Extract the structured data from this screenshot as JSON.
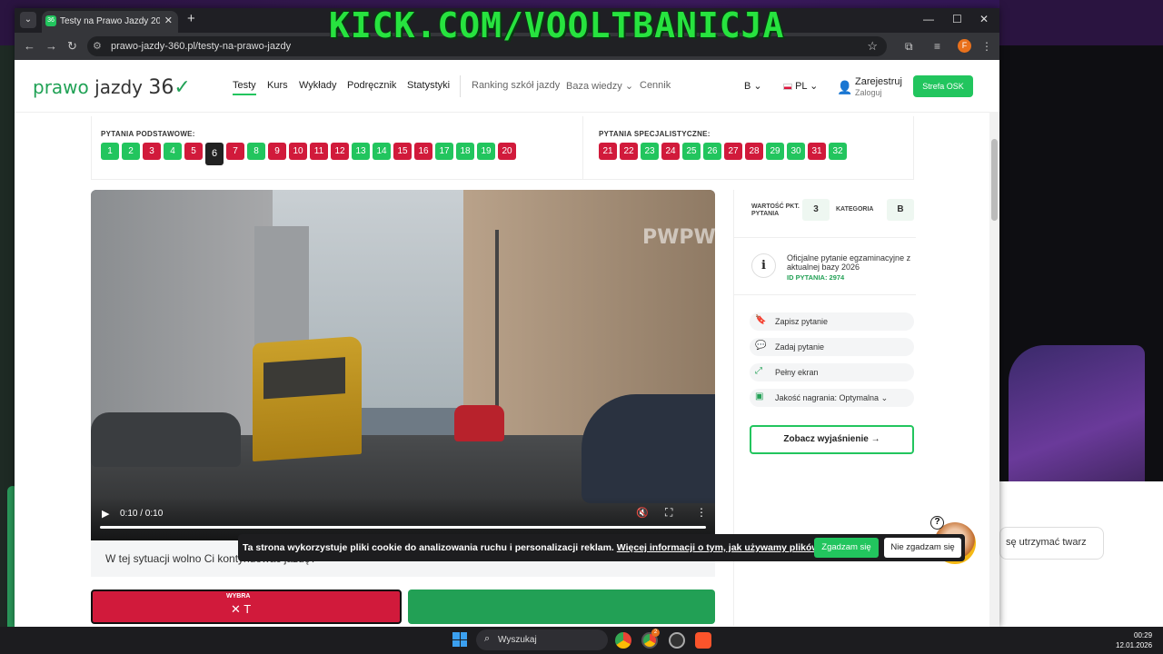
{
  "overlay": {
    "watermark": "KICK.COM/VOOLTBANICJA"
  },
  "browser": {
    "tab_title": "Testy na Prawo Jazdy 2026 - Da",
    "tab_favicon": "36",
    "url": "prawo-jazdy-360.pl/testy-na-prawo-jazdy",
    "profile_initial": "F"
  },
  "site": {
    "logo": {
      "word1": "prawo",
      "word2": "jazdy",
      "num": "36"
    },
    "menu": [
      "Testy",
      "Kurs",
      "Wykłady",
      "Podręcznik",
      "Statystyki"
    ],
    "menu_secondary": [
      "Ranking szkół jazdy",
      "Baza wiedzy",
      "Cennik"
    ],
    "category_select": "B",
    "language_select": "PL",
    "register": "Zarejestruj",
    "login": "Zaloguj",
    "osk_button": "Strefa OSK"
  },
  "questions": {
    "basic_label": "PYTANIA PODSTAWOWE:",
    "special_label": "PYTANIA SPECJALISTYCZNE:",
    "current": 6,
    "basic": [
      {
        "n": "1",
        "s": "g"
      },
      {
        "n": "2",
        "s": "g"
      },
      {
        "n": "3",
        "s": "r"
      },
      {
        "n": "4",
        "s": "g"
      },
      {
        "n": "5",
        "s": "r"
      },
      {
        "n": "6",
        "s": "cur"
      },
      {
        "n": "7",
        "s": "r"
      },
      {
        "n": "8",
        "s": "g"
      },
      {
        "n": "9",
        "s": "r"
      },
      {
        "n": "10",
        "s": "r"
      },
      {
        "n": "11",
        "s": "r"
      },
      {
        "n": "12",
        "s": "r"
      },
      {
        "n": "13",
        "s": "g"
      },
      {
        "n": "14",
        "s": "g"
      },
      {
        "n": "15",
        "s": "r"
      },
      {
        "n": "16",
        "s": "r"
      },
      {
        "n": "17",
        "s": "g"
      },
      {
        "n": "18",
        "s": "g"
      },
      {
        "n": "19",
        "s": "g"
      },
      {
        "n": "20",
        "s": "r"
      }
    ],
    "special": [
      {
        "n": "21",
        "s": "r"
      },
      {
        "n": "22",
        "s": "r"
      },
      {
        "n": "23",
        "s": "g"
      },
      {
        "n": "24",
        "s": "r"
      },
      {
        "n": "25",
        "s": "g"
      },
      {
        "n": "26",
        "s": "g"
      },
      {
        "n": "27",
        "s": "r"
      },
      {
        "n": "28",
        "s": "r"
      },
      {
        "n": "29",
        "s": "g"
      },
      {
        "n": "30",
        "s": "g"
      },
      {
        "n": "31",
        "s": "r"
      },
      {
        "n": "32",
        "s": "g"
      }
    ]
  },
  "video": {
    "time": "0:10 / 0:10",
    "watermark": "PWPW",
    "progress": 1.0
  },
  "question_text": "W tej sytuacji wolno Ci kontynuować jazdę?",
  "answer": {
    "chosen_label": "WYBRA",
    "chosen_initial": "T"
  },
  "side": {
    "points_label": "WARTOŚĆ PKT. PYTANIA",
    "points_value": "3",
    "category_label": "KATEGORIA",
    "category_value": "B",
    "info_text": "Oficjalne pytanie egzaminacyjne z aktualnej bazy 2026",
    "info_id": "ID PYTANIA: 2974",
    "buttons": [
      "Zapisz pytanie",
      "Zadaj pytanie",
      "Pełny ekran",
      "Jakość nagrania: Optymalna"
    ],
    "explain": "Zobacz wyjaśnienie →"
  },
  "cookie": {
    "text": "Ta strona wykorzystuje pliki cookie do analizowania ruchu i personalizacji reklam. ",
    "link": "Więcej informacji o tym, jak używamy plików cookie",
    "accept": "Zgadzam się",
    "reject": "Nie zgadzam się"
  },
  "background_chat": {
    "message": "sę utrzymać twarz"
  },
  "taskbar": {
    "search": "Wyszukaj",
    "time": "00:29",
    "date": "12.01.2026",
    "badge": "2"
  },
  "colors": {
    "green": "#22c55e",
    "red": "#d11a3b",
    "dark": "#222222"
  }
}
